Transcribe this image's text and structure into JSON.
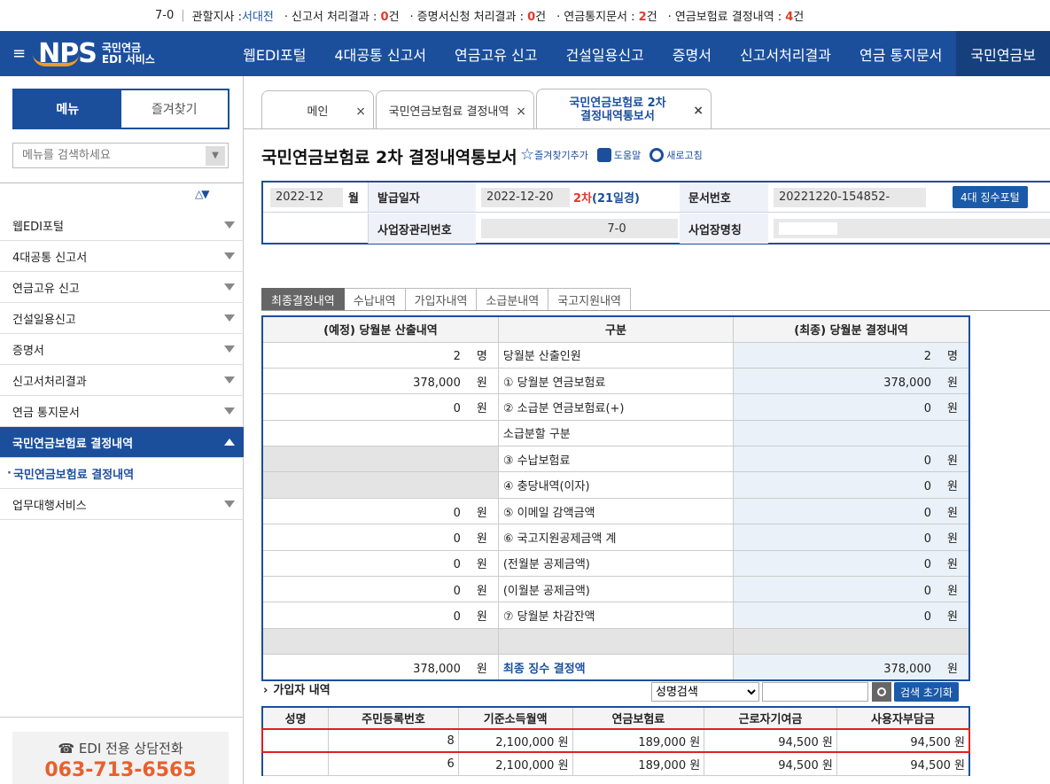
{
  "topbar": {
    "workplace_suffix": "7-0",
    "branch_label": "관할지사 : ",
    "branch_value": "서대전",
    "items": [
      {
        "label": "신고서 처리결과 : ",
        "count": "0",
        "unit": "건"
      },
      {
        "label": "증명서신청 처리결과 : ",
        "count": "0",
        "unit": "건"
      },
      {
        "label": "연금통지문서 : ",
        "count": "2",
        "unit": "건"
      },
      {
        "label": "연금보험료 결정내역 : ",
        "count": "4",
        "unit": "건"
      }
    ]
  },
  "brand": {
    "logo_text": "NPS",
    "sub_line1": "국민연금",
    "sub_line2": "EDI 서비스"
  },
  "nav": [
    "웹EDI포털",
    "4대공통 신고서",
    "연금고유 신고",
    "건설일용신고",
    "증명서",
    "신고서처리결과",
    "연금 통지문서",
    "국민연금보"
  ],
  "sidebar": {
    "tab_menu": "메뉴",
    "tab_favorites": "즐겨찾기",
    "search_placeholder": "메뉴를 검색하세요",
    "items": [
      "웹EDI포털",
      "4대공통 신고서",
      "연금고유 신고",
      "건설일용신고",
      "증명서",
      "신고서처리결과",
      "연금 통지문서"
    ],
    "active_item": "국민연금보험료 결정내역",
    "active_sub": "국민연금보험료 결정내역",
    "after_items": [
      "업무대행서비스"
    ],
    "phone_title": "☎ EDI 전용 상담전화",
    "phone_number": "063-713-6565"
  },
  "tabs": [
    {
      "label": "메인"
    },
    {
      "label": "국민연금보험료 결정내역"
    },
    {
      "label_line1": "국민연금보험료 2차",
      "label_line2": "결정내역통보서"
    }
  ],
  "page": {
    "title": "국민연금보험료 2차 결정내역통보서",
    "fav_add": "즐겨찾기추가",
    "help": "도움말",
    "refresh": "새로고침"
  },
  "info": {
    "ym": "2022-12",
    "ym_unit": "월",
    "issue_label": "발급일자",
    "issue_date": "2022-12-20",
    "round": "2차",
    "elapsed": "(21일경)",
    "doc_label": "문서번호",
    "doc_no": "20221220-154852-",
    "portal_btn": "4대 징수포털",
    "mgmt_label": "사업장관리번호",
    "mgmt_no": "7-0",
    "name_label": "사업장명칭"
  },
  "subtabs": [
    "최종결정내역",
    "수납내역",
    "가입자내역",
    "소급분내역",
    "국고지원내역"
  ],
  "main_table": {
    "headers": [
      "(예정) 당월분 산출내역",
      "구분",
      "(최종) 당월분 결정내역"
    ],
    "rows": [
      {
        "left": "2",
        "lunit": "명",
        "desc": "당월분 산출인원",
        "right": "2",
        "runit": "명"
      },
      {
        "left": "378,000",
        "lunit": "원",
        "desc": "① 당월분 연금보험료",
        "right": "378,000",
        "runit": "원"
      },
      {
        "left": "0",
        "lunit": "원",
        "desc": "② 소급분 연금보험료(+)",
        "right": "0",
        "runit": "원"
      },
      {
        "left": "",
        "lunit": "",
        "desc": "소급분할 구분",
        "right": "",
        "runit": ""
      },
      {
        "left": "",
        "lunit": "",
        "desc": "③ 수납보험료",
        "right": "0",
        "runit": "원",
        "gray": true
      },
      {
        "left": "",
        "lunit": "",
        "desc": "④ 충당내역(이자)",
        "right": "0",
        "runit": "원",
        "gray": true
      },
      {
        "left": "0",
        "lunit": "원",
        "desc": "⑤ 이메일 감액금액",
        "right": "0",
        "runit": "원"
      },
      {
        "left": "0",
        "lunit": "원",
        "desc": "⑥ 국고지원공제금액 계",
        "right": "0",
        "runit": "원"
      },
      {
        "left": "0",
        "lunit": "원",
        "desc": "(전월분 공제금액)",
        "right": "0",
        "runit": "원"
      },
      {
        "left": "0",
        "lunit": "원",
        "desc": "(이월분 공제금액)",
        "right": "0",
        "runit": "원"
      },
      {
        "left": "0",
        "lunit": "원",
        "desc": "⑦ 당월분 차감잔액",
        "right": "0",
        "runit": "원"
      },
      {
        "left": "",
        "lunit": "",
        "desc": "",
        "right": "",
        "runit": "",
        "allgray": true
      },
      {
        "left": "378,000",
        "lunit": "원",
        "desc": "최종 징수 결정액",
        "right": "378,000",
        "runit": "원",
        "final": true
      }
    ]
  },
  "subscribers": {
    "title": "가입자 내역",
    "select_value": "성명검색",
    "reset_btn": "검색 초기화",
    "headers": [
      "성명",
      "주민등록번호",
      "기준소득월액",
      "연금보험료",
      "근로자기여금",
      "사용자부담금"
    ],
    "rows": [
      {
        "name": "",
        "rrn": "8",
        "income": "2,100,000 원",
        "premium": "189,000 원",
        "employee": "94,500 원",
        "employer": "94,500 원"
      },
      {
        "name": "",
        "rrn": "6",
        "income": "2,100,000 원",
        "premium": "189,000 원",
        "employee": "94,500 원",
        "employer": "94,500 원"
      }
    ]
  }
}
